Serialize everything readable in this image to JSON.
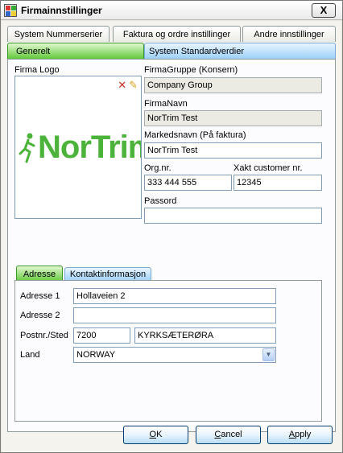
{
  "window": {
    "title": "Firmainnstillinger",
    "close_glyph": "X"
  },
  "tabs": {
    "row1": [
      "System Nummerserier",
      "Faktura og ordre instillinger",
      "Andre innstillinger"
    ],
    "row2": [
      "Generelt",
      "System Standardverdier"
    ]
  },
  "general": {
    "logo_label": "Firma Logo",
    "logo_text": "NorTrim",
    "logo_delete_icon": "red-x-icon",
    "logo_edit_icon": "pencil-icon",
    "firmagruppe_label": "FirmaGruppe (Konsern)",
    "firmagruppe_value": "Company Group",
    "firmanavn_label": "FirmaNavn",
    "firmanavn_value": "NorTrim Test",
    "markedsnavn_label": "Markedsnavn (På faktura)",
    "markedsnavn_value": "NorTrim Test",
    "orgnr_label": "Org.nr.",
    "orgnr_value": "333 444 555",
    "xakt_label": "Xakt customer nr.",
    "xakt_value": "12345",
    "passord_label": "Passord",
    "passord_value": ""
  },
  "inner_tabs": [
    "Adresse",
    "Kontaktinformasjon"
  ],
  "address": {
    "adresse1_label": "Adresse 1",
    "adresse1_value": "Hollaveien 2",
    "adresse2_label": "Adresse 2",
    "adresse2_value": "",
    "postnr_label": "Postnr./Sted",
    "postnr_value": "7200",
    "sted_value": "KYRKSÆTERØRA",
    "land_label": "Land",
    "land_value": "NORWAY"
  },
  "buttons": {
    "ok_mn": "O",
    "ok_rest": "K",
    "cancel_mn": "C",
    "cancel_rest": "ancel",
    "apply_mn": "A",
    "apply_rest": "pply"
  },
  "colors": {
    "selected_tab": "#62c93b",
    "blue_tab": "#9bd0f8",
    "logo_green": "#4bb33a"
  }
}
